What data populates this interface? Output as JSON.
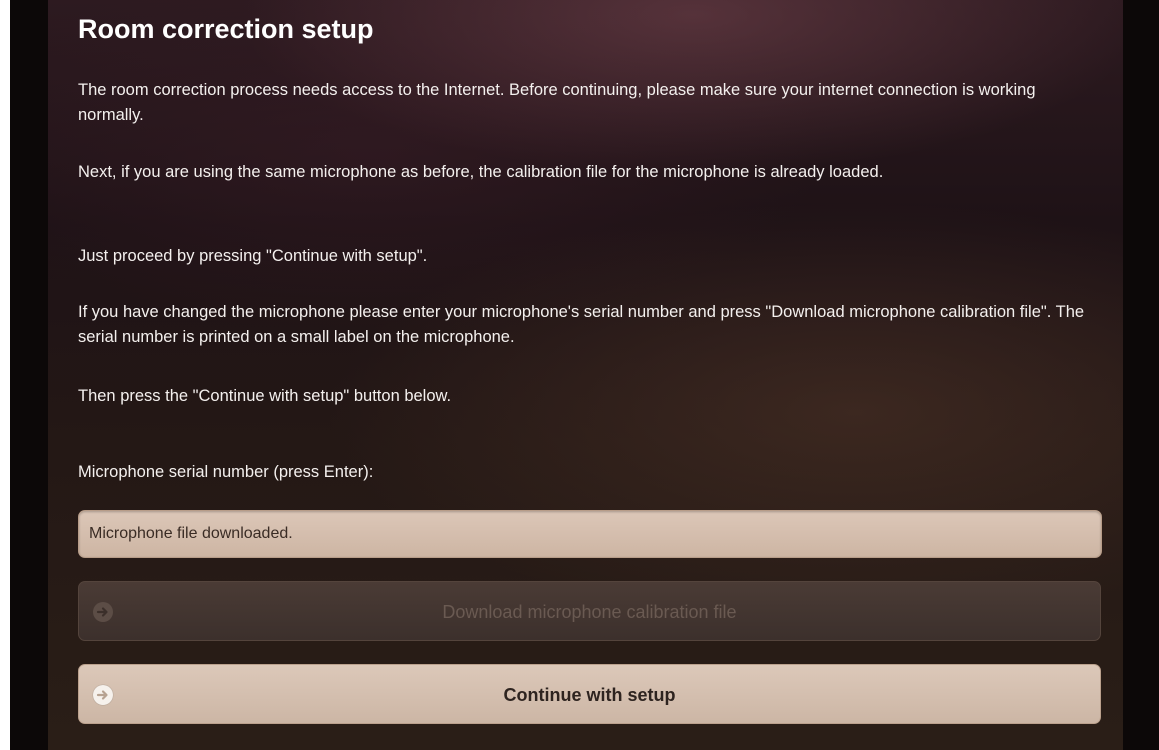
{
  "page": {
    "title": "Room correction setup"
  },
  "paragraphs": {
    "internet": "The room correction process needs access to the Internet. Before continuing, please make sure your internet connection is working normally.",
    "same_mic": "Next, if you are using the same microphone as before, the calibration file for the microphone is already loaded.",
    "proceed": "Just proceed by pressing \"Continue with setup\".",
    "changed_mic": "If you have changed the microphone please enter your microphone's serial number and press \"Download microphone calibration file\". The serial number is printed on a small label on the microphone.",
    "then": "Then press the \"Continue with setup\" button below."
  },
  "serial": {
    "label": "Microphone serial number (press Enter):",
    "value": "Microphone file downloaded."
  },
  "buttons": {
    "download": {
      "label": "Download microphone calibration file",
      "icon": "arrow-right-circle-icon",
      "state": "disabled"
    },
    "continue": {
      "label": "Continue with setup",
      "icon": "arrow-right-circle-icon",
      "state": "enabled"
    }
  },
  "colors": {
    "text": "#f4f0ee",
    "field_background": "#d6c0b0",
    "button_enabled": "#d5c0b0",
    "button_disabled": "#43352f"
  }
}
